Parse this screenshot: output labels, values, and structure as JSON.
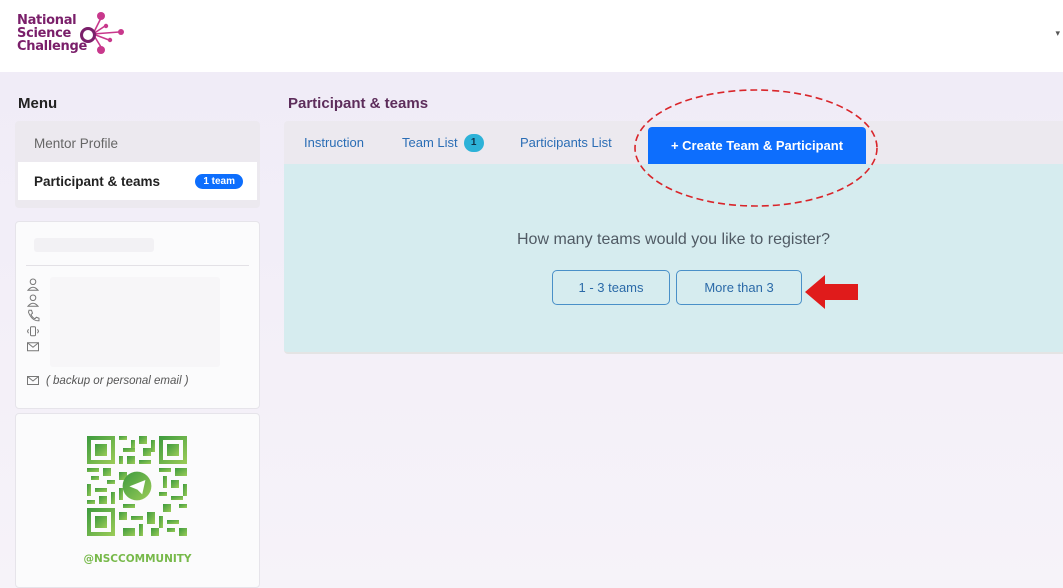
{
  "header": {
    "logo_lines": [
      "National",
      "Science",
      "Challenge"
    ],
    "caret": "▾"
  },
  "sidebar": {
    "menu_title": "Menu",
    "items": [
      {
        "label": "Mentor Profile"
      },
      {
        "label": "Participant & teams",
        "badge": "1 team",
        "active": true
      }
    ],
    "profile": {
      "icons": [
        "user-icon",
        "user-icon",
        "phone-icon",
        "mobile-vibrate-icon",
        "email-icon",
        "email-icon"
      ],
      "backup_email_note": "( backup or personal email )"
    },
    "community": {
      "qr": "qr-code",
      "handle": "@NSCCOMMUNITY"
    }
  },
  "main": {
    "page_title": "Participant & teams",
    "tabs": [
      {
        "label": "Instruction"
      },
      {
        "label": "Team List",
        "count": "1"
      },
      {
        "label": "Participants List"
      },
      {
        "label": "+ Create Team & Participant",
        "active": true
      }
    ],
    "question": "How many teams would you like to register?",
    "options": [
      "1 - 3 teams",
      "More than 3"
    ]
  },
  "colors": {
    "brand": "#7a1f6a",
    "accent": "#0d6efd",
    "panel": "#d6ecef",
    "annotation": "#d9252a",
    "qr": "#77b94a"
  }
}
